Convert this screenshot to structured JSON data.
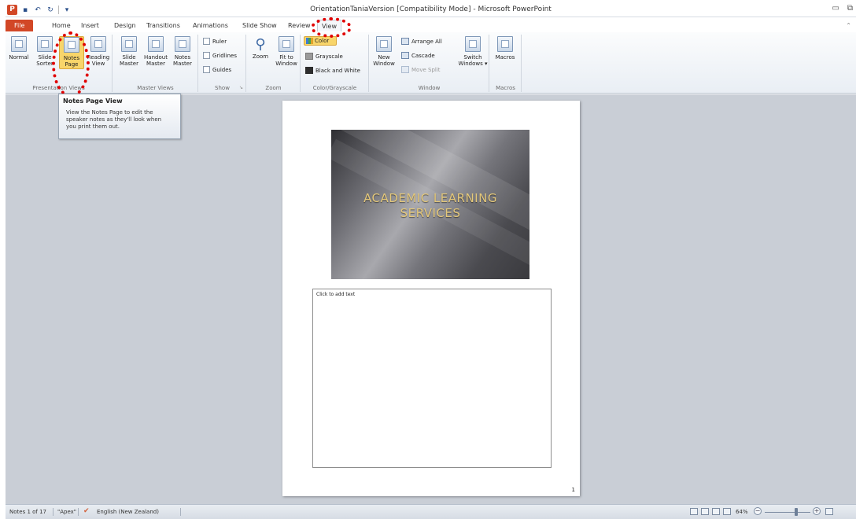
{
  "titlebar": {
    "app_icon": "P",
    "title": "OrientationTaniaVersion [Compatibility Mode] - Microsoft PowerPoint",
    "qat_icons": [
      "save-icon",
      "undo-icon",
      "redo-icon",
      "customize-icon"
    ]
  },
  "tabs": [
    {
      "label": "File"
    },
    {
      "label": "Home"
    },
    {
      "label": "Insert"
    },
    {
      "label": "Design"
    },
    {
      "label": "Transitions"
    },
    {
      "label": "Animations"
    },
    {
      "label": "Slide Show"
    },
    {
      "label": "Review"
    },
    {
      "label": "View"
    }
  ],
  "ribbon": {
    "presentation_views": {
      "label": "Presentation Views",
      "normal": "Normal",
      "slide_sorter_1": "Slide",
      "slide_sorter_2": "Sorter",
      "notes_page_1": "Notes",
      "notes_page_2": "Page",
      "reading_view_1": "Reading",
      "reading_view_2": "View"
    },
    "master_views": {
      "label": "Master Views",
      "slide_master_1": "Slide",
      "slide_master_2": "Master",
      "handout_master_1": "Handout",
      "handout_master_2": "Master",
      "notes_master_1": "Notes",
      "notes_master_2": "Master"
    },
    "show": {
      "label": "Show",
      "ruler": "Ruler",
      "gridlines": "Gridlines",
      "guides": "Guides"
    },
    "zoom": {
      "label": "Zoom",
      "zoom": "Zoom",
      "fit_1": "Fit to",
      "fit_2": "Window"
    },
    "color": {
      "label": "Color/Grayscale",
      "color": "Color",
      "grayscale": "Grayscale",
      "black_white": "Black and White"
    },
    "window": {
      "label": "Window",
      "new_window_1": "New",
      "new_window_2": "Window",
      "arrange_all": "Arrange All",
      "cascade": "Cascade",
      "move_split": "Move Split",
      "switch_1": "Switch",
      "switch_2": "Windows ▾"
    },
    "macros": {
      "label": "Macros",
      "macros": "Macros"
    }
  },
  "tooltip": {
    "title": "Notes Page View",
    "line1": "View the Notes Page to edit the",
    "line2": "speaker notes as they'll look when",
    "line3": "you print them out."
  },
  "slide": {
    "title_line1": "ACADEMIC LEARNING",
    "title_line2": "SERVICES"
  },
  "notes": {
    "placeholder": "Click to add text",
    "page_number": "1"
  },
  "statusbar": {
    "position": "Notes 1 of 17",
    "theme": "\"Apex\"",
    "language": "English (New Zealand)",
    "zoom": "64%"
  },
  "colors": {
    "file_tab": "#d24726",
    "selected_button": "#f8d56a",
    "highlight_ring": "#e00000",
    "workspace": "#c9ced6"
  }
}
